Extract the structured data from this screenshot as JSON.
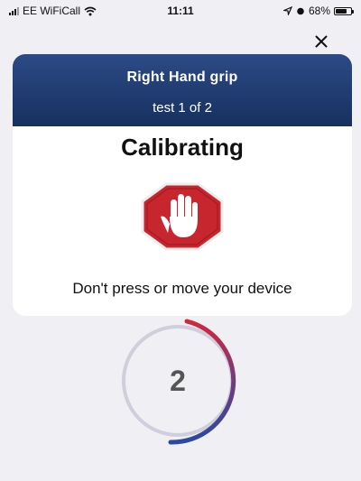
{
  "status_bar": {
    "carrier": "EE WiFiCall",
    "time": "11:11",
    "battery": "68%"
  },
  "card": {
    "title": "Right Hand grip",
    "subtitle": "test 1 of 2",
    "heading": "Calibrating",
    "instruction": "Don't press or move your device"
  },
  "countdown": {
    "value": "2"
  },
  "colors": {
    "header_top": "#2c4a86",
    "header_bottom": "#16315f",
    "stop_red": "#c8262e",
    "arc_red": "#d1283a",
    "arc_blue": "#2a4aa0",
    "ring_grey": "#cfcfdc",
    "background": "#efeff4"
  },
  "icons": [
    "wifi-icon",
    "location-arrow-icon",
    "alarm-icon",
    "battery-icon",
    "close-icon",
    "stop-hand-icon"
  ]
}
